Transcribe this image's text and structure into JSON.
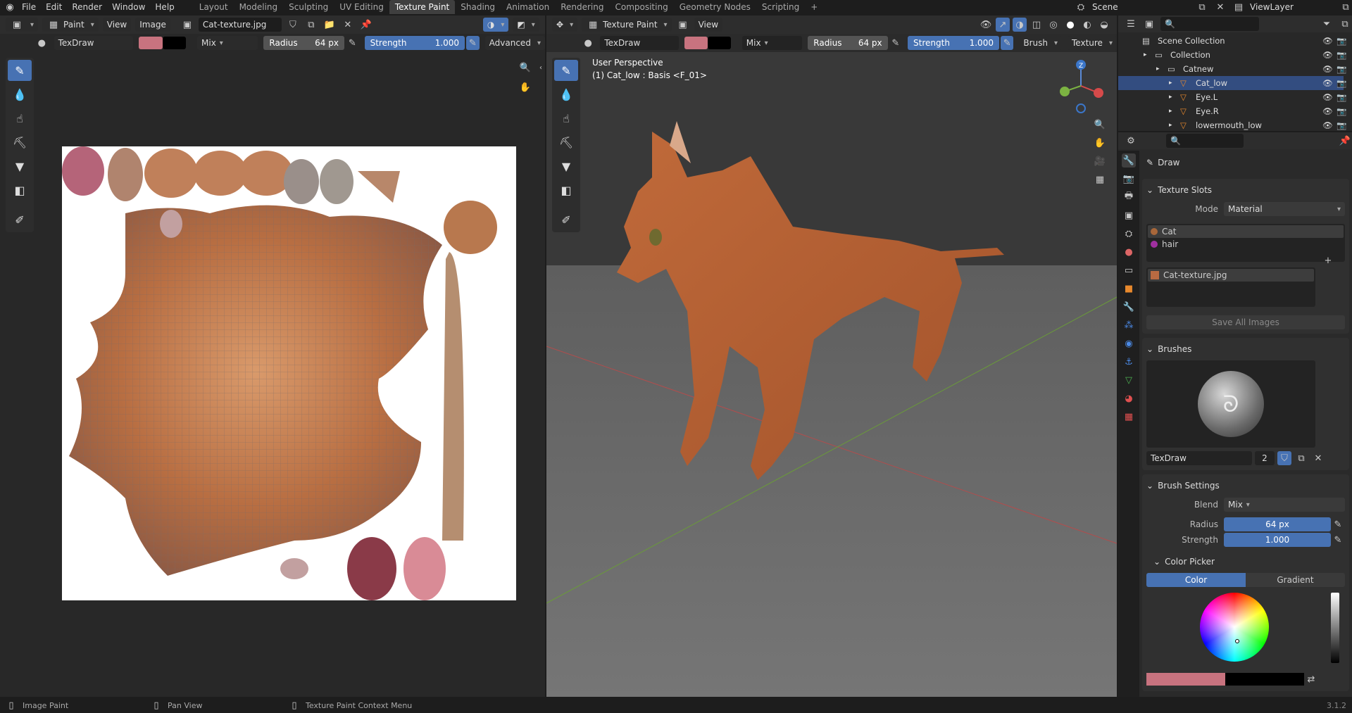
{
  "menu": {
    "items": [
      "File",
      "Edit",
      "Render",
      "Window",
      "Help"
    ]
  },
  "workspaces": {
    "tabs": [
      "Layout",
      "Modeling",
      "Sculpting",
      "UV Editing",
      "Texture Paint",
      "Shading",
      "Animation",
      "Rendering",
      "Compositing",
      "Geometry Nodes",
      "Scripting"
    ],
    "active": "Texture Paint",
    "add": "+"
  },
  "scene": {
    "name": "Scene",
    "view_layer": "ViewLayer"
  },
  "image_editor": {
    "mode": "Paint",
    "view": "View",
    "image": "Image",
    "image_name": "Cat-texture.jpg",
    "brush": "TexDraw",
    "blend": "Mix",
    "radius_label": "Radius",
    "radius_value": "64 px",
    "strength_label": "Strength",
    "strength_value": "1.000",
    "advanced": "Advanced"
  },
  "viewport": {
    "mode": "Texture Paint",
    "view": "View",
    "brush": "TexDraw",
    "blend": "Mix",
    "radius_label": "Radius",
    "radius_value": "64 px",
    "strength_label": "Strength",
    "strength_value": "1.000",
    "brush_menu": "Brush",
    "texture_menu": "Texture",
    "perspective": "User Perspective",
    "object_info": "(1) Cat_low : Basis <F_01>"
  },
  "outliner": {
    "rows": [
      {
        "name": "Scene Collection",
        "indent": 0
      },
      {
        "name": "Collection",
        "indent": 1
      },
      {
        "name": "Catnew",
        "indent": 2
      },
      {
        "name": "Cat_low",
        "indent": 3,
        "selected": true
      },
      {
        "name": "Eye.L",
        "indent": 3
      },
      {
        "name": "Eye.R",
        "indent": 3
      },
      {
        "name": "lowermouth_low",
        "indent": 3
      }
    ]
  },
  "properties": {
    "tool_name": "Draw",
    "texture_slots": {
      "title": "Texture Slots",
      "mode_label": "Mode",
      "mode_value": "Material",
      "materials": [
        "Cat",
        "hair"
      ],
      "slot_image": "Cat-texture.jpg",
      "save_all": "Save All Images"
    },
    "brushes": {
      "title": "Brushes",
      "name": "TexDraw",
      "users": "2"
    },
    "brush_settings": {
      "title": "Brush Settings",
      "blend_label": "Blend",
      "blend_value": "Mix",
      "radius_label": "Radius",
      "radius_value": "64 px",
      "strength_label": "Strength",
      "strength_value": "1.000"
    },
    "color_picker": {
      "title": "Color Picker",
      "tab_color": "Color",
      "tab_gradient": "Gradient"
    }
  },
  "status": {
    "left": "Image Paint",
    "mid": "Pan View",
    "right": "Texture Paint Context Menu",
    "version": "3.1.2"
  },
  "colors": {
    "accent": "#4772b3",
    "primary_color": "#c8737f",
    "secondary_color": "#000000"
  }
}
